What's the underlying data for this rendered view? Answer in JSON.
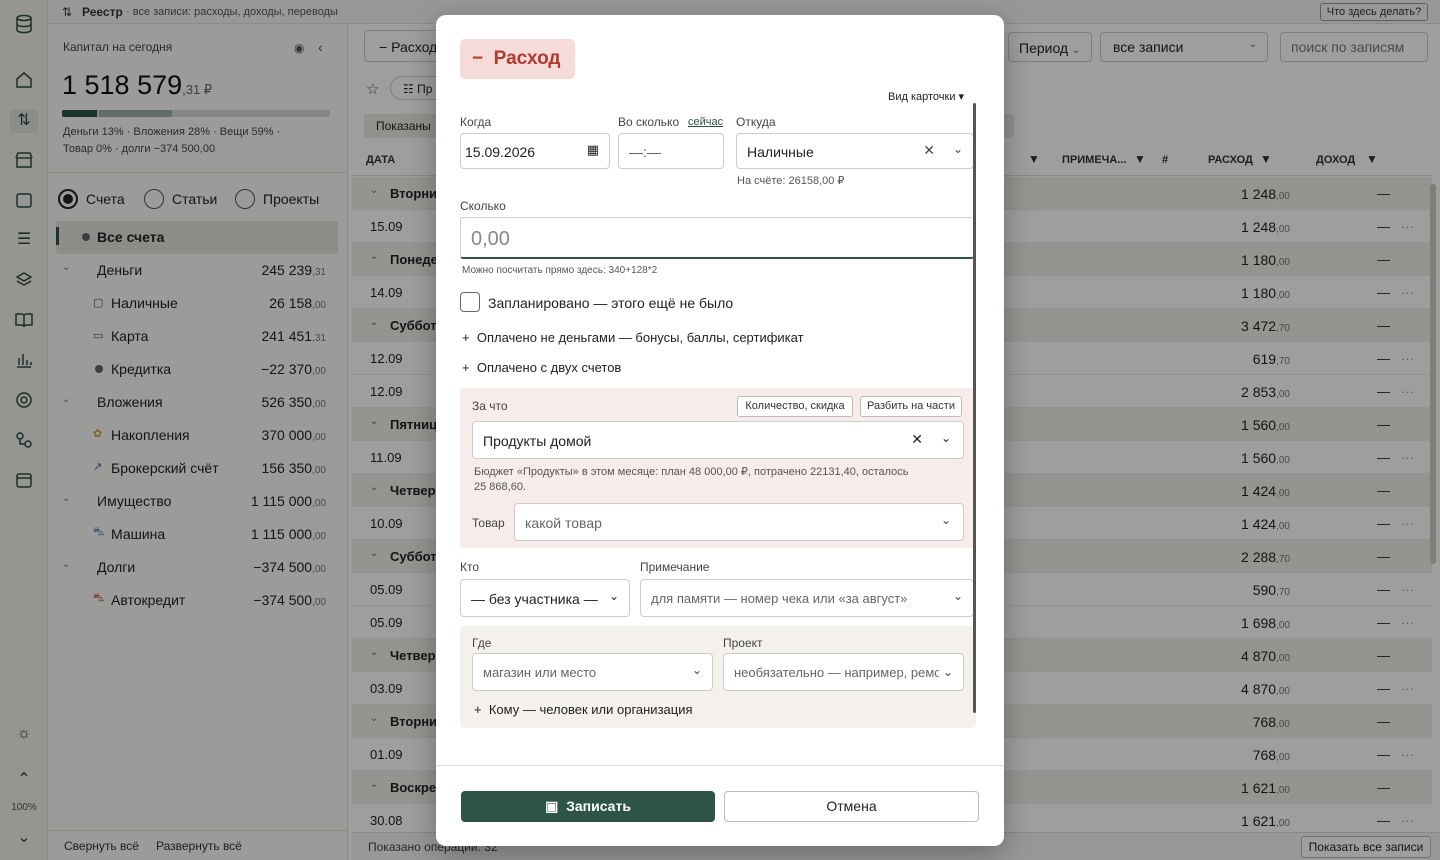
{
  "topbar": {
    "title": "Реестр",
    "subtitle": "· все записи: расходы, доходы, переводы",
    "help_button": "Что здесь делать?"
  },
  "capital": {
    "label": "Капитал на сегодня",
    "amount_main": "1 518 579",
    "amount_frac": ",31 ₽",
    "breakdown_line1": "Деньги 13% · Вложения 28% · Вещи 59% ·",
    "breakdown_line2": "Товар 0% · долги −374 500,00"
  },
  "view_tabs": [
    "Счета",
    "Статьи",
    "Проекты"
  ],
  "accounts": [
    {
      "name": "Все счета",
      "int": "",
      "frac": ""
    },
    {
      "name": "Деньги",
      "int": "245 239",
      "frac": ",31"
    },
    {
      "name": "Наличные",
      "int": "26 158",
      "frac": ",00"
    },
    {
      "name": "Карта",
      "int": "241 451",
      "frac": ",31"
    },
    {
      "name": "Кредитка",
      "int": "−22 370",
      "frac": ",00"
    },
    {
      "name": "Вложения",
      "int": "526 350",
      "frac": ",00"
    },
    {
      "name": "Накопления",
      "int": "370 000",
      "frac": ",00"
    },
    {
      "name": "Брокерский счёт",
      "int": "156 350",
      "frac": ",00"
    },
    {
      "name": "Имущество",
      "int": "1 115 000",
      "frac": ",00"
    },
    {
      "name": "Машина",
      "int": "1 115 000",
      "frac": ",00"
    },
    {
      "name": "Долги",
      "int": "−374 500",
      "frac": ",00"
    },
    {
      "name": "Автокредит",
      "int": "−374 500",
      "frac": ",00"
    }
  ],
  "left_footer": {
    "collapse": "Свернуть всё",
    "expand": "Развернуть всё"
  },
  "zoom": "100%",
  "toolbar": {
    "add_expense": "Расход",
    "period": "Период",
    "filter": "все записи",
    "search_placeholder": "поиск по записям",
    "shown_label": "Показаны",
    "pr_label": "Пр"
  },
  "table": {
    "headers": {
      "date": "ДАТА",
      "note": "ПРИМЕЧА...",
      "num": "#",
      "expense": "РАСХОД",
      "income": "ДОХОД"
    },
    "rows": [
      {
        "type": "grp",
        "date": "Вторни",
        "int": "1 248",
        "frac": ",00"
      },
      {
        "type": "item",
        "date": "15.09",
        "int": "1 248",
        "frac": ",00"
      },
      {
        "type": "grp",
        "date": "Понеде",
        "int": "1 180",
        "frac": ",00"
      },
      {
        "type": "item",
        "date": "14.09",
        "int": "1 180",
        "frac": ",00"
      },
      {
        "type": "grp",
        "date": "Суббот",
        "int": "3 472",
        "frac": ",70"
      },
      {
        "type": "item",
        "date": "12.09",
        "int": "619",
        "frac": ",70"
      },
      {
        "type": "item",
        "date": "12.09",
        "int": "2 853",
        "frac": ",00"
      },
      {
        "type": "grp",
        "date": "Пятниц",
        "int": "1 560",
        "frac": ",00"
      },
      {
        "type": "item",
        "date": "11.09",
        "int": "1 560",
        "frac": ",00"
      },
      {
        "type": "grp",
        "date": "Четвер",
        "int": "1 424",
        "frac": ",00"
      },
      {
        "type": "item",
        "date": "10.09",
        "int": "1 424",
        "frac": ",00"
      },
      {
        "type": "grp",
        "date": "Суббот",
        "int": "2 288",
        "frac": ",70"
      },
      {
        "type": "item",
        "date": "05.09",
        "int": "590",
        "frac": ",70"
      },
      {
        "type": "item",
        "date": "05.09",
        "int": "1 698",
        "frac": ",00"
      },
      {
        "type": "grp",
        "date": "Четвер",
        "int": "4 870",
        "frac": ",00"
      },
      {
        "type": "item",
        "date": "03.09",
        "int": "4 870",
        "frac": ",00"
      },
      {
        "type": "grp",
        "date": "Вторни",
        "int": "768",
        "frac": ",00"
      },
      {
        "type": "item",
        "date": "01.09",
        "int": "768",
        "frac": ",00"
      },
      {
        "type": "grp",
        "date": "Воскре",
        "int": "1 621",
        "frac": ",00"
      },
      {
        "type": "item",
        "date": "30.08",
        "int": "1 621",
        "frac": ",00"
      }
    ],
    "income_dash": "—",
    "footer_shown": "Показано операций: 32",
    "footer_show_all": "Показать все записи"
  },
  "modal": {
    "type_label": "Расход",
    "card_view": "Вид карточки ▾",
    "when_label": "Когда",
    "when_value": "15.09.2026",
    "time_label": "Во сколько",
    "time_now": "сейчас",
    "time_value": "—:—",
    "from_label": "Откуда",
    "from_value": "Наличные",
    "from_balance": "На счёте: 26158,00 ₽",
    "amount_label": "Сколько",
    "amount_placeholder": "0,00",
    "amount_hint": "Можно посчитать прямо здесь: 340+128*2",
    "planned_label": "Запланировано — этого ещё не было",
    "nonmoney_label": "Оплачено не деньгами — бонусы, баллы, сертификат",
    "two_accounts_label": "Оплачено с двух счетов",
    "for_what_label": "За что",
    "qty_button": "Количество, скидка",
    "split_button": "Разбить на части",
    "category_value": "Продукты домой",
    "budget_line1": "Бюджет «Продукты» в этом месяце: план 48 000,00 ₽, потрачено 22131,40, осталось",
    "budget_line2": "25 868,60.",
    "goods_label": "Товар",
    "goods_placeholder": "какой товар",
    "who_label": "Кто",
    "who_value": "— без участника —",
    "note_label": "Примечание",
    "note_placeholder": "для памяти — номер чека или «за август»",
    "where_label": "Где",
    "where_placeholder": "магазин или место",
    "project_label": "Проект",
    "project_placeholder": "необязательно — например, ремонт",
    "to_whom_label": "Кому — человек или организация",
    "save_button": "Записать",
    "cancel_button": "Отмена"
  },
  "colors": {
    "accent": "#2d5446",
    "expense_bg": "#f6dcd8",
    "expense_text": "#b03a2e",
    "for_what_bg": "#f7ecea",
    "where_bg": "#f4f1ec"
  }
}
